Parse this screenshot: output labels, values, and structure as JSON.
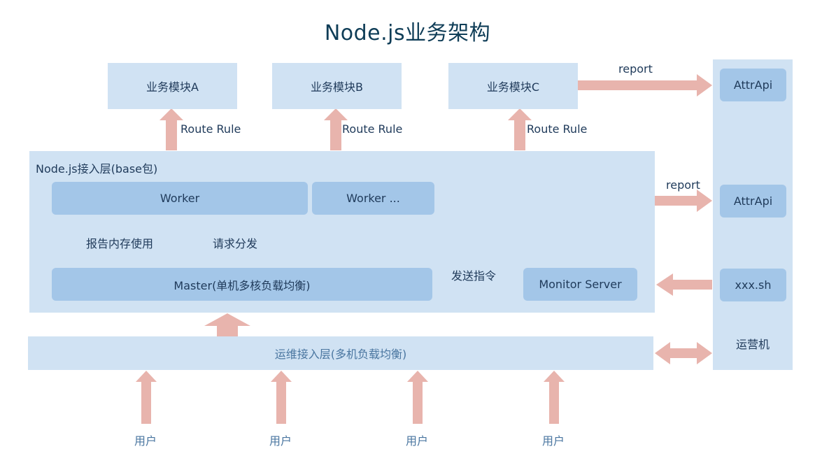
{
  "title": "Node.js业务架构",
  "modules": [
    "业务模块A",
    "业务模块B",
    "业务模块C"
  ],
  "route_rule": "Route Rule",
  "access_layer": {
    "label": "Node.js接入层(base包)",
    "worker": "Worker",
    "worker_more": "Worker ...",
    "master": "Master(单机多核负载均衡)",
    "monitor": "Monitor Server",
    "report_memory": "报告内存使用",
    "dispatch_request": "请求分发",
    "send_command": "发送指令"
  },
  "report": "report",
  "ops_layer": "运维接入层(多机负载均衡)",
  "ops_machine": {
    "label": "运营机",
    "attr_api": "AttrApi",
    "script": "xxx.sh"
  },
  "user": "用户",
  "colors": {
    "light_panel": "#d0e2f3",
    "mid_panel": "#a3c6e8",
    "arrow": "#e8b4ad",
    "title": "#0f3d57"
  }
}
